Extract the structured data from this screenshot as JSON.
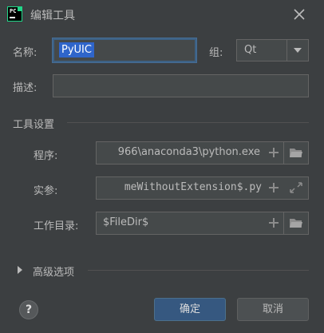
{
  "window": {
    "title": "编辑工具",
    "app_icon_text": "PC"
  },
  "form": {
    "name_label": "名称:",
    "name_value": "PyUIC",
    "group_label": "组:",
    "group_value": "Qt",
    "description_label": "描述:",
    "description_value": ""
  },
  "tool_settings": {
    "section_title": "工具设置",
    "program_label": "程序:",
    "program_value": "966\\anaconda3\\python.exe",
    "args_label": "实参:",
    "args_value": "meWithoutExtension$.py",
    "workdir_label": "工作目录:",
    "workdir_value": "$FileDir$"
  },
  "advanced": {
    "label": "高级选项"
  },
  "buttons": {
    "help": "?",
    "ok": "确定",
    "cancel": "取消"
  },
  "colors": {
    "background": "#3c3f41",
    "field": "#45494a",
    "focus_border": "#3d6185",
    "selection": "#2f65ca",
    "primary_button": "#365880"
  }
}
